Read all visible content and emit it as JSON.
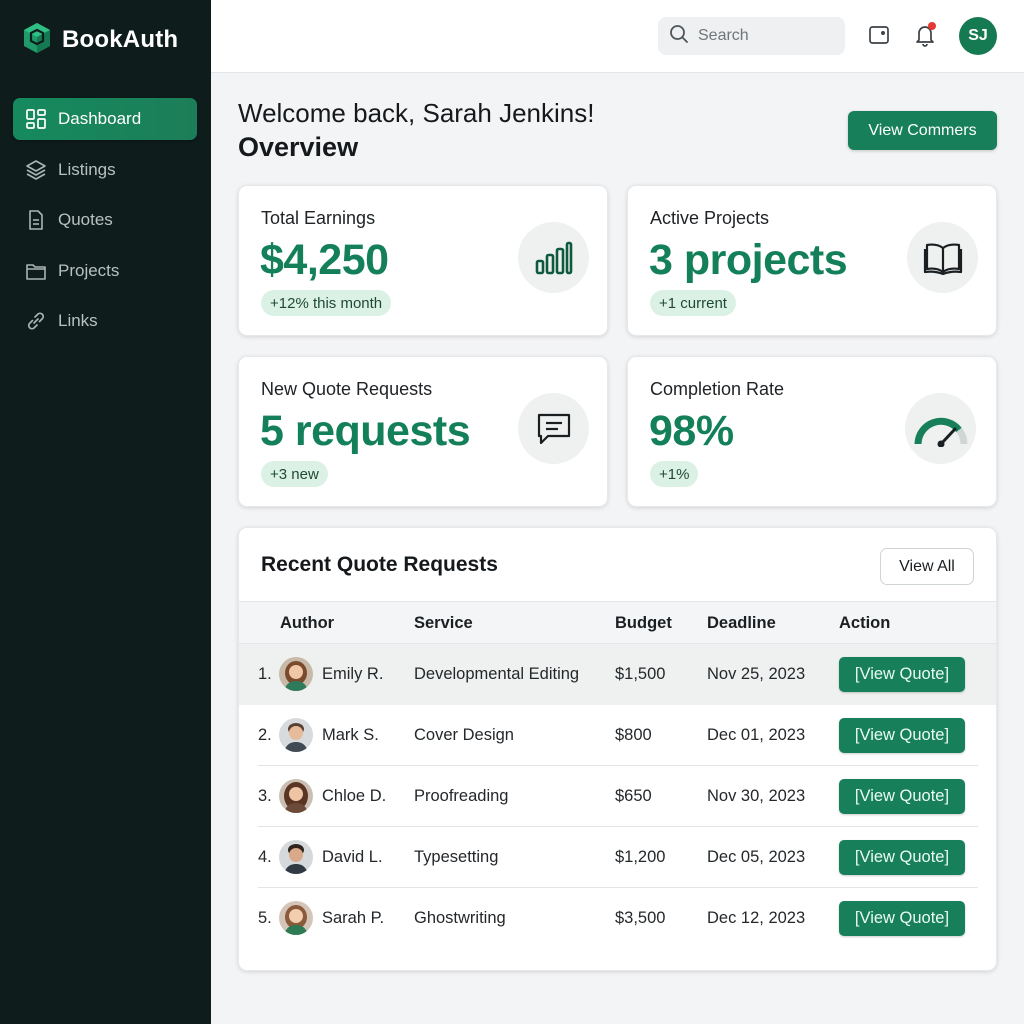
{
  "app": {
    "brand": "BookAuth",
    "accent": "#17805a",
    "sidebar_bg": "#0e1c1c"
  },
  "sidebar": {
    "items": [
      {
        "label": "Dashboard",
        "icon": "dashboard-icon",
        "active": true
      },
      {
        "label": "Listings",
        "icon": "layers-icon",
        "active": false
      },
      {
        "label": "Quotes",
        "icon": "document-icon",
        "active": false
      },
      {
        "label": "Projects",
        "icon": "folder-icon",
        "active": false
      },
      {
        "label": "Links",
        "icon": "link-icon",
        "active": false
      }
    ]
  },
  "topbar": {
    "search_placeholder": "Search",
    "icons": [
      "search-icon",
      "wallet-icon",
      "bell-icon"
    ],
    "notification_dot_color": "#e53935",
    "avatar_initials": "SJ"
  },
  "header": {
    "welcome": "Welcome back, Sarah Jenkins!",
    "title": "Overview",
    "primary_button": "View Commers"
  },
  "stats": [
    {
      "label": "Total Earnings",
      "value": "$4,250",
      "badge": "+12% this month",
      "icon": "bar-chart-icon"
    },
    {
      "label": "Active Projects",
      "value": "3 projects",
      "badge": "+1 current",
      "icon": "book-icon"
    },
    {
      "label": "New Quote Requests",
      "value": "5 requests",
      "badge": "+3 new",
      "icon": "message-icon"
    },
    {
      "label": "Completion Rate",
      "value": "98%",
      "badge": "+1%",
      "icon": "gauge-icon"
    }
  ],
  "quotes": {
    "title": "Recent Quote Requests",
    "view_all": "View All",
    "columns": [
      "Author",
      "Service",
      "Budget",
      "Deadline",
      "Action"
    ],
    "rows": [
      {
        "num": "1.",
        "author": "Emily R.",
        "service": "Developmental Editing",
        "budget": "$1,500",
        "deadline": "Nov 25, 2023",
        "action": "[View Quote]"
      },
      {
        "num": "2.",
        "author": "Mark S.",
        "service": "Cover Design",
        "budget": "$800",
        "deadline": "Dec 01, 2023",
        "action": "[View Quote]"
      },
      {
        "num": "3.",
        "author": "Chloe D.",
        "service": "Proofreading",
        "budget": "$650",
        "deadline": "Nov 30, 2023",
        "action": "[View Quote]"
      },
      {
        "num": "4.",
        "author": "David L.",
        "service": "Typesetting",
        "budget": "$1,200",
        "deadline": "Dec 05, 2023",
        "action": "[View Quote]"
      },
      {
        "num": "5.",
        "author": "Sarah P.",
        "service": "Ghostwriting",
        "budget": "$3,500",
        "deadline": "Dec 12, 2023",
        "action": "[View Quote]"
      }
    ]
  }
}
